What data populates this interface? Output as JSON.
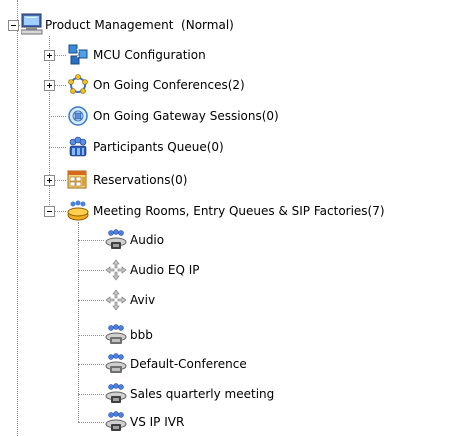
{
  "root": {
    "label": "Product Management  (Normal)",
    "icon": "server-monitor-icon",
    "expanded": true
  },
  "items": [
    {
      "label": "MCU Configuration",
      "icon": "mcu-configuration-icon",
      "expander": "collapsed"
    },
    {
      "label": "On Going Conferences(2)",
      "icon": "conferences-ring-icon",
      "expander": "collapsed"
    },
    {
      "label": "On Going Gateway Sessions(0)",
      "icon": "gateway-globe-icon",
      "expander": "none"
    },
    {
      "label": "Participants Queue(0)",
      "icon": "participants-queue-icon",
      "expander": "none"
    },
    {
      "label": "Reservations(0)",
      "icon": "reservations-calendar-icon",
      "expander": "collapsed"
    },
    {
      "label": "Meeting Rooms, Entry Queues & SIP Factories(7)",
      "icon": "meeting-rooms-icon",
      "expander": "expanded"
    }
  ],
  "meeting_rooms": [
    {
      "label": "Audio",
      "icon": "meeting-room-phone-icon"
    },
    {
      "label": "Audio EQ IP",
      "icon": "entry-queue-arrows-icon"
    },
    {
      "label": "Aviv",
      "icon": "entry-queue-arrows-icon"
    },
    {
      "label": "bbb",
      "icon": "meeting-room-people-icon"
    },
    {
      "label": "Default-Conference",
      "icon": "meeting-room-people-icon"
    },
    {
      "label": "Sales quarterly meeting",
      "icon": "meeting-room-phone-icon"
    },
    {
      "label": "VS IP IVR",
      "icon": "meeting-room-phone-icon"
    }
  ],
  "colors": {
    "tree_line": "#909090",
    "text": "#000000",
    "background": "#ffffff"
  }
}
